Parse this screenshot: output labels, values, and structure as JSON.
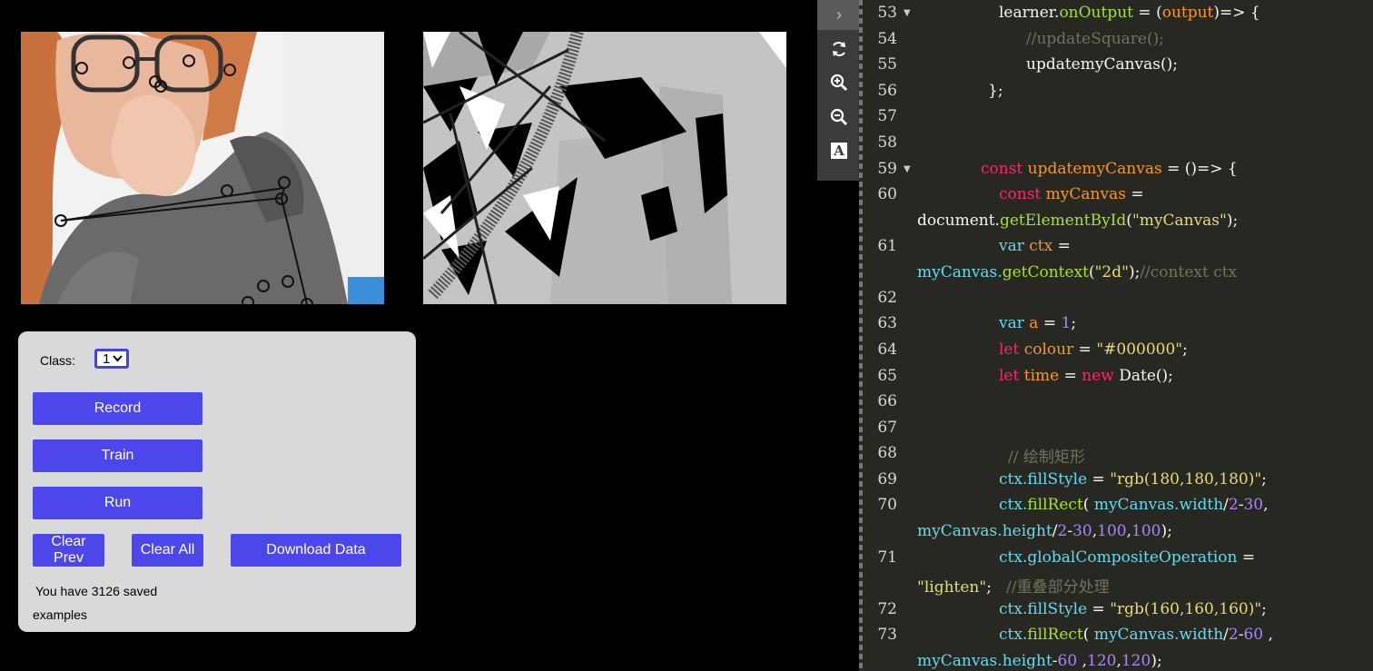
{
  "panel": {
    "class_label": "Class:",
    "class_value": "1",
    "record": "Record",
    "train": "Train",
    "run": "Run",
    "clear_prev_1": "Clear",
    "clear_prev_2": "Prev",
    "clear_all": "Clear All",
    "download": "Download Data",
    "status_1": "You have 3126 saved",
    "status_2": "examples"
  },
  "toolbar": {
    "collapse": "›",
    "icons": [
      "refresh-icon",
      "zoom-in-icon",
      "zoom-out-icon",
      "font-icon"
    ],
    "font_glyph": "A"
  },
  "editor": {
    "lines": [
      {
        "n": "53",
        "fold": true
      },
      {
        "n": "54"
      },
      {
        "n": "55"
      },
      {
        "n": "56"
      },
      {
        "n": "57"
      },
      {
        "n": "58"
      },
      {
        "n": "59",
        "fold": true
      },
      {
        "n": "60"
      },
      {
        "n": "61"
      },
      {
        "n": "62"
      },
      {
        "n": "63"
      },
      {
        "n": "64"
      },
      {
        "n": "65"
      },
      {
        "n": "66"
      },
      {
        "n": "67"
      },
      {
        "n": "68"
      },
      {
        "n": "69"
      },
      {
        "n": "70"
      },
      {
        "n": "71"
      },
      {
        "n": "72"
      },
      {
        "n": "73"
      }
    ],
    "code": {
      "l53a": "learner.",
      "l53b": "onOutput",
      "l53c": " = (",
      "l53d": "output",
      "l53e": ")=> {",
      "l54": "//updateSquare();",
      "l55": "updatemyCanvas();",
      "l56": "};",
      "l59a": "const ",
      "l59b": "updatemyCanvas",
      "l59c": " = ()=> {",
      "l60a": "const ",
      "l60b": "myCanvas",
      "l60c": " =",
      "l60d": "document.",
      "l60e": "getElementById",
      "l60f": "(",
      "l60g": "\"myCanvas\"",
      "l60h": ");",
      "l61a": "var ",
      "l61b": "ctx",
      "l61c": " =",
      "l61d": "myCanvas.",
      "l61e": "getContext",
      "l61f": "(",
      "l61g": "\"2d\"",
      "l61h": ");",
      "l61i": "//context ctx",
      "l63a": "var ",
      "l63b": "a",
      "l63c": " = ",
      "l63d": "1",
      "l63e": ";",
      "l64a": "let ",
      "l64b": "colour",
      "l64c": " = ",
      "l64d": "\"#000000\"",
      "l64e": ";",
      "l65a": "let ",
      "l65b": "time",
      "l65c": " = ",
      "l65d": "new ",
      "l65e": "Date();",
      "l68": "// 绘制矩形",
      "l69a": "ctx.",
      "l69b": "fillStyle",
      "l69c": " = ",
      "l69d": "\"rgb(180,180,180)\"",
      "l69e": ";",
      "l70a": "ctx.",
      "l70b": "fillRect",
      "l70c": "( ",
      "l70d": "myCanvas.",
      "l70e": "width",
      "l70f": "/",
      "l70g": "2",
      "l70h": "-",
      "l70i": "30",
      "l70j": ",",
      "l70k": "myCanvas.",
      "l70l": "height",
      "l70m": "/",
      "l70n": "2",
      "l70o": "-",
      "l70p": "30",
      "l70q": ",",
      "l70r": "100",
      "l70s": ",",
      "l70t": "100",
      "l70u": ");",
      "l71a": "ctx.",
      "l71b": "globalCompositeOperation",
      "l71c": " =",
      "l71d": "\"lighten\"",
      "l71e": ";   ",
      "l71f": "//重叠部分处理",
      "l72a": "ctx.",
      "l72b": "fillStyle",
      "l72c": " = ",
      "l72d": "\"rgb(160,160,160)\"",
      "l72e": ";",
      "l73a": "ctx.",
      "l73b": "fillRect",
      "l73c": "( ",
      "l73d": "myCanvas.",
      "l73e": "width",
      "l73f": "/",
      "l73g": "2",
      "l73h": "-",
      "l73i": "60",
      "l73j": " ,",
      "l73k": "myCanvas.",
      "l73l": "height",
      "l73m": "-",
      "l73n": "60",
      "l73o": " ,",
      "l73p": "120",
      "l73q": ",",
      "l73r": "120",
      "l73s": ");"
    }
  }
}
